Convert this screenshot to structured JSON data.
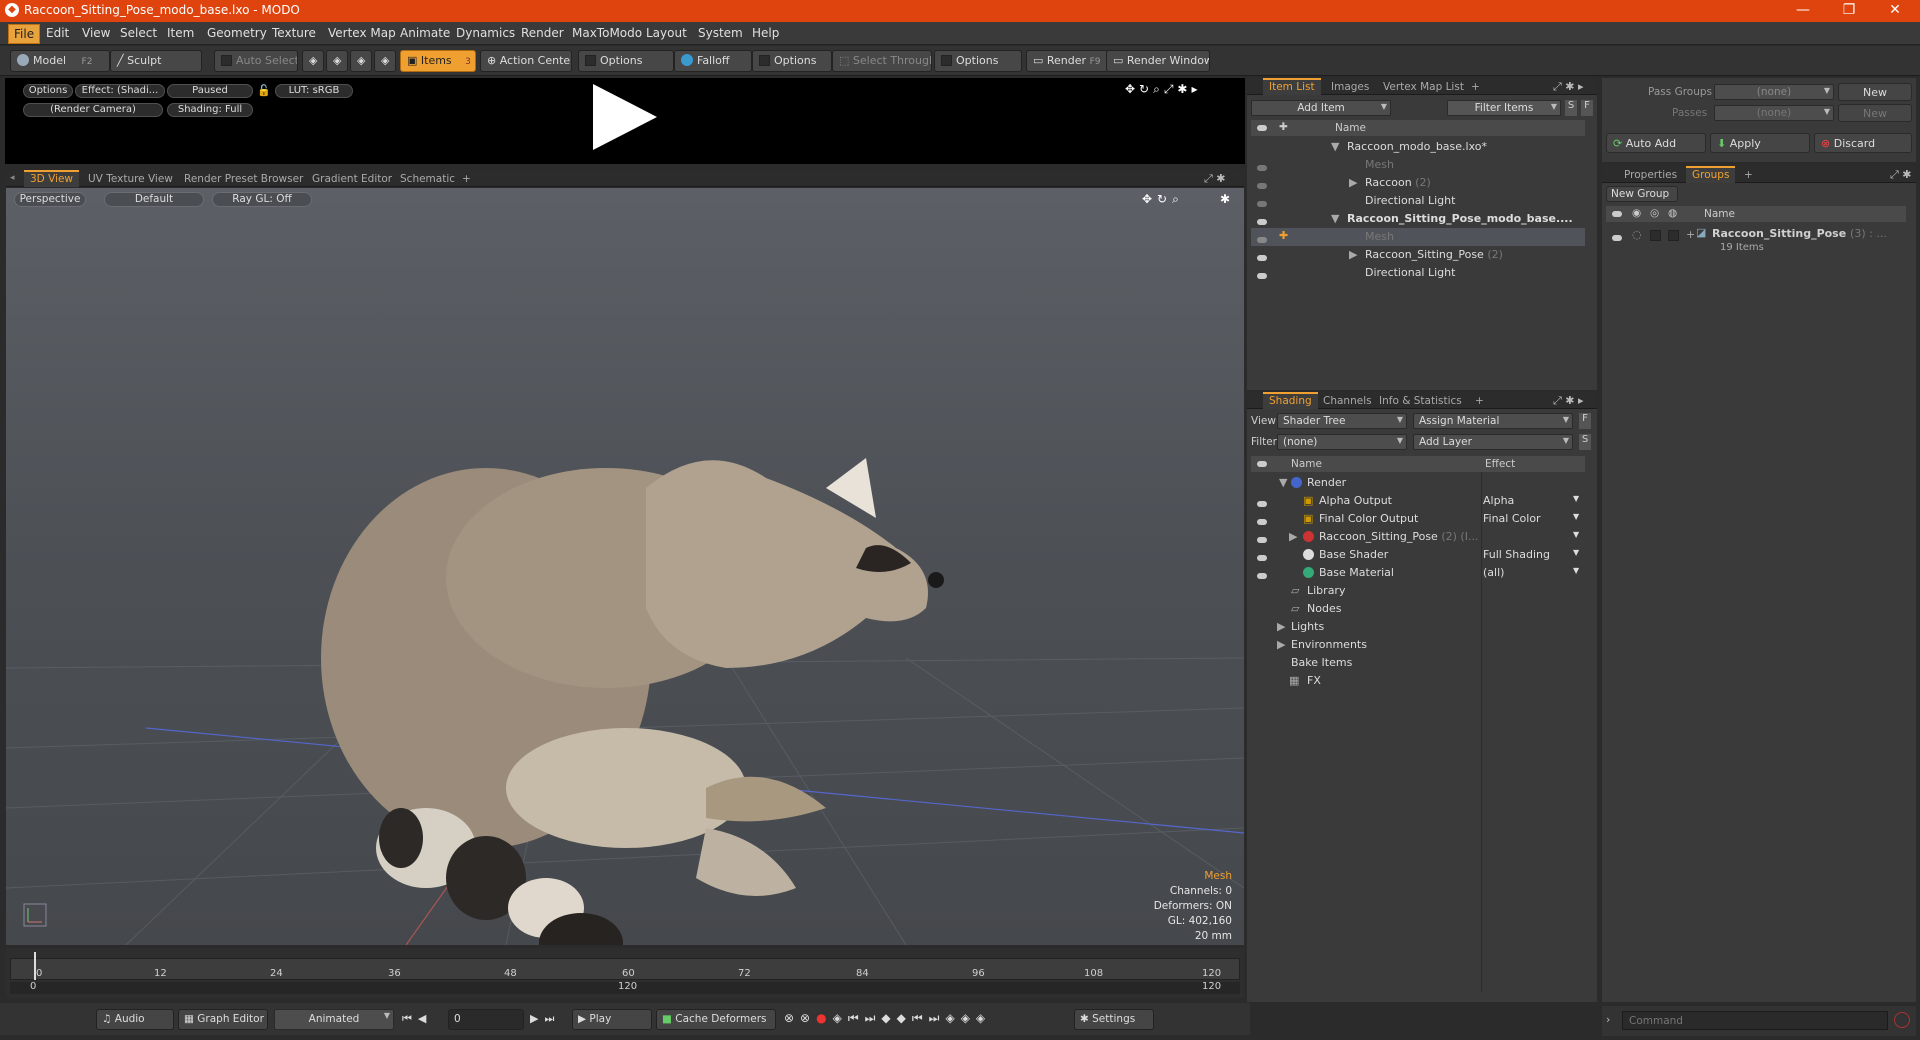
{
  "app": {
    "title": "Raccoon_Sitting_Pose_modo_base.lxo - MODO"
  },
  "menu": [
    "File",
    "Edit",
    "View",
    "Select",
    "Item",
    "Geometry",
    "Texture",
    "Vertex Map",
    "Animate",
    "Dynamics",
    "Render",
    "MaxToModo",
    "Layout",
    "System",
    "Help"
  ],
  "toolbar": {
    "model": "Model",
    "model_key": "F2",
    "sculpt": "Sculpt",
    "auto_select": "Auto Select",
    "items": "Items",
    "items_key": "3",
    "action_center": "Action Center",
    "options1": "Options",
    "falloff": "Falloff",
    "options2": "Options",
    "select_through": "Select Through",
    "options3": "Options",
    "render": "Render",
    "render_key": "F9",
    "render_window": "Render Window"
  },
  "render_preview": {
    "options": "Options",
    "effect": "Effect: (Shadi...",
    "paused": "Paused",
    "lut": "LUT: sRGB",
    "camera": "(Render Camera)",
    "shading": "Shading: Full"
  },
  "view_tabs": [
    "3D View",
    "UV Texture View",
    "Render Preset Browser",
    "Gradient Editor",
    "Schematic",
    "+"
  ],
  "viewport": {
    "perspective": "Perspective",
    "default": "Default",
    "raygl": "Ray GL: Off",
    "info_mesh": "Mesh",
    "info_channels": "Channels: 0",
    "info_deformers": "Deformers: ON",
    "info_gl": "GL: 402,160",
    "info_mm": "20 mm"
  },
  "timeline": {
    "ticks": [
      "0",
      "12",
      "24",
      "36",
      "48",
      "60",
      "72",
      "84",
      "96",
      "108",
      "120"
    ],
    "start": "0",
    "mid": "120",
    "end": "120"
  },
  "bottom": {
    "audio": "Audio",
    "graph_editor": "Graph Editor",
    "animated": "Animated",
    "frame": "0",
    "play": "Play",
    "cache": "Cache Deformers",
    "settings": "Settings"
  },
  "itemlist": {
    "tabs": [
      "Item List",
      "Images",
      "Vertex Map List",
      "+"
    ],
    "add_item": "Add Item",
    "filter": "Filter Items",
    "s": "S",
    "f": "F",
    "col_name": "Name",
    "rows": [
      {
        "label": "Raccoon_modo_base.lxo*",
        "suffix": ""
      },
      {
        "label": "Mesh",
        "suffix": ""
      },
      {
        "label": "Raccoon",
        "suffix": "(2)"
      },
      {
        "label": "Directional Light",
        "suffix": ""
      },
      {
        "label": "Raccoon_Sitting_Pose_modo_base....",
        "suffix": ""
      },
      {
        "label": "Mesh",
        "suffix": ""
      },
      {
        "label": "Raccoon_Sitting_Pose",
        "suffix": "(2)"
      },
      {
        "label": "Directional Light",
        "suffix": ""
      }
    ]
  },
  "shading": {
    "tabs": [
      "Shading",
      "Channels",
      "Info & Statistics",
      "+"
    ],
    "view_label": "View",
    "view_value": "Shader Tree",
    "assign": "Assign Material",
    "filter_label": "Filter",
    "filter_value": "(none)",
    "add_layer": "Add Layer",
    "col_name": "Name",
    "col_effect": "Effect",
    "rows": [
      {
        "label": "Render",
        "effect": ""
      },
      {
        "label": "Alpha Output",
        "effect": "Alpha"
      },
      {
        "label": "Final Color Output",
        "effect": "Final Color"
      },
      {
        "label": "Raccoon_Sitting_Pose",
        "effect": "",
        "suffix": "(2) (I..."
      },
      {
        "label": "Base Shader",
        "effect": "Full Shading"
      },
      {
        "label": "Base Material",
        "effect": "(all)"
      },
      {
        "label": "Library",
        "effect": ""
      },
      {
        "label": "Nodes",
        "effect": ""
      },
      {
        "label": "Lights",
        "effect": ""
      },
      {
        "label": "Environments",
        "effect": ""
      },
      {
        "label": "Bake Items",
        "effect": ""
      },
      {
        "label": "FX",
        "effect": ""
      }
    ]
  },
  "passes": {
    "pass_groups": "Pass Groups",
    "passes": "Passes",
    "none": "(none)",
    "new": "New",
    "auto_add": "Auto Add",
    "apply": "Apply",
    "discard": "Discard"
  },
  "groups": {
    "tabs": [
      "Properties",
      "Groups",
      "+"
    ],
    "new_group": "New Group",
    "col_name": "Name",
    "group_name": "Raccoon_Sitting_Pose",
    "group_suffix": "(3) : ...",
    "group_items": "19 Items"
  },
  "command": {
    "placeholder": "Command"
  }
}
